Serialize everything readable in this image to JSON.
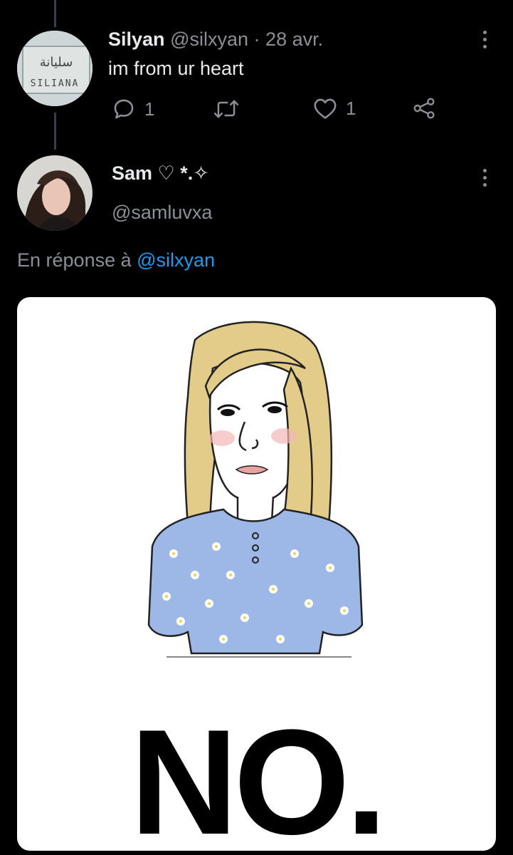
{
  "tweet1": {
    "name": "Silyan",
    "handle": "@silxyan",
    "separator": "·",
    "date": "28 avr.",
    "text": "im from ur heart",
    "avatar_sign_arabic": "سليانة",
    "avatar_sign_latin": "SILIANA",
    "reply_count": "1",
    "like_count": "1",
    "icons": [
      "reply-icon",
      "retweet-icon",
      "like-icon",
      "share-icon",
      "more-icon"
    ]
  },
  "tweet2": {
    "name": "Sam ♡ *.✧",
    "handle": "@samluvxa",
    "reply_prefix": "En réponse à",
    "reply_to": "@silxyan",
    "media_caption": "NO."
  },
  "colors": {
    "background": "#000000",
    "text": "#e7e9ea",
    "muted": "#8b9096",
    "link": "#1d9bf0"
  }
}
